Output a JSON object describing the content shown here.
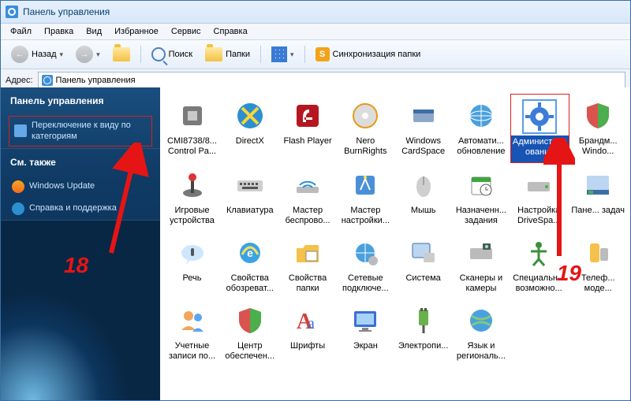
{
  "window": {
    "title": "Панель управления"
  },
  "menu": [
    "Файл",
    "Правка",
    "Вид",
    "Избранное",
    "Сервис",
    "Справка"
  ],
  "toolbar": {
    "back": "Назад",
    "search": "Поиск",
    "folders": "Папки",
    "sync": "Синхронизация папки"
  },
  "address": {
    "label": "Адрес:",
    "value": "Панель управления"
  },
  "sidebar": {
    "section1": {
      "title": "Панель управления",
      "items": [
        "Переключение к виду по категориям"
      ]
    },
    "section2": {
      "title": "См. также",
      "items": [
        "Windows Update",
        "Справка и поддержка"
      ]
    }
  },
  "annotations": {
    "num18": "18",
    "num19": "19"
  },
  "grid_items": [
    {
      "label": "CMI8738/8... Control Pa...",
      "icon": "chip"
    },
    {
      "label": "DirectX",
      "icon": "directx"
    },
    {
      "label": "Flash Player",
      "icon": "flash"
    },
    {
      "label": "Nero BurnRights",
      "icon": "nero"
    },
    {
      "label": "Windows CardSpace",
      "icon": "cardspace"
    },
    {
      "label": "Автомати... обновление",
      "icon": "globe"
    },
    {
      "label": "Администрирование",
      "icon": "gear",
      "selected": true,
      "annot_box": true
    },
    {
      "label": "Брандм... Windo...",
      "icon": "shield"
    },
    {
      "label": "Игровые устройства",
      "icon": "joystick"
    },
    {
      "label": "Клавиатура",
      "icon": "keyboard"
    },
    {
      "label": "Мастер беспрово...",
      "icon": "wifi"
    },
    {
      "label": "Мастер настройки...",
      "icon": "wizard"
    },
    {
      "label": "Мышь",
      "icon": "mouse"
    },
    {
      "label": "Назначенн... задания",
      "icon": "scheduled"
    },
    {
      "label": "Настройка DriveSpa...",
      "icon": "drive"
    },
    {
      "label": "Пане... задач",
      "icon": "taskbar"
    },
    {
      "label": "Речь",
      "icon": "speech"
    },
    {
      "label": "Свойства обозреват...",
      "icon": "ie"
    },
    {
      "label": "Свойства папки",
      "icon": "folderprops"
    },
    {
      "label": "Сетевые подключе...",
      "icon": "network"
    },
    {
      "label": "Система",
      "icon": "system"
    },
    {
      "label": "Сканеры и камеры",
      "icon": "scanner"
    },
    {
      "label": "Специальн... возможно...",
      "icon": "access"
    },
    {
      "label": "Телеф... моде...",
      "icon": "phone"
    },
    {
      "label": "Учетные записи по...",
      "icon": "users"
    },
    {
      "label": "Центр обеспечен...",
      "icon": "security"
    },
    {
      "label": "Шрифты",
      "icon": "fonts"
    },
    {
      "label": "Экран",
      "icon": "display"
    },
    {
      "label": "Электропи...",
      "icon": "power"
    },
    {
      "label": "Язык и региональ...",
      "icon": "regional"
    }
  ],
  "icon_svgs": {
    "chip": "<svg class='icn' viewBox='0 0 40 40'><rect x='8' y='8' width='24' height='24' rx='3' fill='#7a7a7a'/><rect x='14' y='14' width='12' height='12' fill='#c9c9c9'/></svg>",
    "directx": "<svg class='icn' viewBox='0 0 40 40'><circle cx='20' cy='20' r='16' fill='#2c8fd0'/><path d='M10,10 L30,30 M30,10 L10,30' stroke='#ffd53a' stroke-width='4'/></svg>",
    "flash": "<svg class='icn' viewBox='0 0 40 40'><rect x='6' y='6' width='28' height='28' rx='4' fill='#b51720'/><path d='M22,12 q-8,0 -8,10 l0,6 l4,0 l0,-6 q0,-6 4,-6 z M16,22 h10 v3 h-10 z' fill='#fff'/></svg>",
    "nero": "<svg class='icn' viewBox='0 0 40 40'><circle cx='20' cy='20' r='15' fill='#dcdcdc'/><circle cx='20' cy='20' r='4' fill='#fff'/><circle cx='20' cy='20' r='15' fill='none' stroke='#e59b1a' stroke-width='2'/></svg>",
    "cardspace": "<svg class='icn' viewBox='0 0 40 40'><rect x='7' y='12' width='26' height='16' rx='2' fill='#8ea7c9'/><rect x='7' y='12' width='26' height='5' fill='#3d6ea6'/></svg>",
    "globe": "<svg class='icn' viewBox='0 0 40 40'><circle cx='20' cy='20' r='14' fill='#4aa0de'/><ellipse cx='20' cy='20' rx='14' ry='6' fill='none' stroke='#fff'/><path d='M20,6 v28 M6,20 h28' stroke='#fff'/></svg>",
    "gear": "<svg class='icn' viewBox='0 0 40 40'><circle cx='20' cy='20' r='12' fill='#3b7dd8'/><circle cx='20' cy='20' r='5' fill='#fff'/><g fill='#3b7dd8'><rect x='18' y='2' width='4' height='6'/><rect x='18' y='32' width='4' height='6'/><rect x='2' y='18' width='6' height='4'/><rect x='32' y='18' width='6' height='4'/></g></svg>",
    "shield": "<svg class='icn' viewBox='0 0 40 40'><path d='M20,4 l14,5 v10 c0,10 -7,15 -14,17 c-7,-2 -14,-7 -14,-17 v-10 z' fill='#d9534f'/><path d='M20,4 l14,5 v10 c0,10 -7,15 -14,17 z' fill='#4cae4c'/></svg>",
    "joystick": "<svg class='icn' viewBox='0 0 40 40'><ellipse cx='20' cy='30' rx='12' ry='5' fill='#777'/><rect x='18' y='12' width='4' height='18' fill='#444'/><circle cx='20' cy='10' r='5' fill='#d33'/></svg>",
    "keyboard": "<svg class='icn' viewBox='0 0 40 40'><rect x='4' y='14' width='32' height='14' rx='2' fill='#cfcfcf'/><g fill='#555'><rect x='7' y='17' width='3' height='3'/><rect x='12' y='17' width='3' height='3'/><rect x='17' y='17' width='3' height='3'/><rect x='22' y='17' width='3' height='3'/><rect x='27' y='17' width='3' height='3'/><rect x='10' y='22' width='20' height='3'/></g></svg>",
    "wifi": "<svg class='icn' viewBox='0 0 40 40'><rect x='6' y='22' width='28' height='8' rx='2' fill='#bbb'/><path d='M10,20 a14,14 0 0 1 20,0' fill='none' stroke='#2c8fd0' stroke-width='2'/><path d='M14,23 a8,8 0 0 1 12,0' fill='none' stroke='#2c8fd0' stroke-width='2'/></svg>",
    "wizard": "<svg class='icn' viewBox='0 0 40 40'><rect x='8' y='8' width='24' height='24' rx='3' fill='#4a90d9'/><path d='M14,26 l6,-14 l6,14' fill='none' stroke='#fff' stroke-width='2'/><circle cx='20' cy='10' r='2' fill='#ffeb3b'/></svg>",
    "mouse": "<svg class='icn' viewBox='0 0 40 40'><ellipse cx='20' cy='22' rx='9' ry='13' fill='#cfcfcf'/><line x1='20' y1='9' x2='20' y2='20' stroke='#777'/></svg>",
    "scheduled": "<svg class='icn' viewBox='0 0 40 40'><rect x='8' y='10' width='24' height='22' rx='2' fill='#fff' stroke='#888'/><rect x='8' y='10' width='24' height='6' fill='#40a540'/><circle cx='26' cy='26' r='7' fill='#fff' stroke='#555'/><path d='M26,22 v4 h3' stroke='#555' fill='none'/></svg>",
    "drive": "<svg class='icn' viewBox='0 0 40 40'><rect x='6' y='16' width='28' height='12' rx='2' fill='#bdbdbd'/><circle cx='30' cy='22' r='2' fill='#4caf50'/></svg>",
    "taskbar": "<svg class='icn' viewBox='0 0 40 40'><rect x='6' y='8' width='28' height='24' rx='2' fill='#bcd6f2'/><rect x='6' y='26' width='28' height='6' fill='#3d6ea6'/><rect x='8' y='27' width='6' height='4' fill='#4caf50'/></svg>",
    "speech": "<svg class='icn' viewBox='0 0 40 40'><ellipse cx='20' cy='20' rx='14' ry='10' fill='#cfe6ff'/><path d='M16,30 l-4,6 l2,-8' fill='#cfe6ff'/><rect x='18' y='14' width='4' height='10' rx='2' fill='#555'/></svg>",
    "ie": "<svg class='icn' viewBox='0 0 40 40'><circle cx='20' cy='20' r='13' fill='#3aa3e3'/><path d='M10,22 q10,-18 20,0' fill='none' stroke='#ffdf5a' stroke-width='3'/><text x='20' y='25' font-size='14' fill='#fff' text-anchor='middle' font-weight='bold'>e</text></svg>",
    "folderprops": "<svg class='icn' viewBox='0 0 40 40'><path d='M6,14 h8 l3,-4 h17 v22 h-28 z' fill='#f4c14a'/><rect x='18' y='18' width='14' height='12' fill='#fff' stroke='#888'/></svg>",
    "network": "<svg class='icn' viewBox='0 0 40 40'><circle cx='20' cy='20' r='12' fill='#4aa0de'/><path d='M8,20 h24 M20,8 v24' stroke='#fff'/><circle cx='30' cy='30' r='6' fill='#bbb'/></svg>",
    "system": "<svg class='icn' viewBox='0 0 40 40'><rect x='6' y='8' width='22' height='18' rx='2' fill='#bcd6f2' stroke='#3d6ea6'/><rect x='20' y='20' width='14' height='12' rx='2' fill='#ccc'/></svg>",
    "scanner": "<svg class='icn' viewBox='0 0 40 40'><rect x='6' y='14' width='28' height='14' rx='2' fill='#bbb'/><rect x='22' y='8' width='10' height='8' rx='1' fill='#555'/><circle cx='27' cy='12' r='2' fill='#7fc'/></svg>",
    "access": "<svg class='icn' viewBox='0 0 40 40'><circle cx='20' cy='10' r='4' fill='#3c8f3c'/><path d='M10,18 h20 M20,14 v14 M20,28 l-7,8 M20,28 l7,8' stroke='#3c8f3c' stroke-width='3' fill='none'/></svg>",
    "phone": "<svg class='icn' viewBox='0 0 40 40'><rect x='10' y='8' width='12' height='24' rx='3' fill='#f4c14a'/><rect x='23' y='14' width='10' height='16' rx='2' fill='#bbb'/></svg>",
    "users": "<svg class='icn' viewBox='0 0 40 40'><circle cx='15' cy='14' r='6' fill='#f2a65a'/><circle cx='27' cy='16' r='5' fill='#5aa6f2'/><path d='M6,32 q9,-10 18,0 z' fill='#f2a65a'/><path d='M20,34 q7,-9 14,0 z' fill='#5aa6f2'/></svg>",
    "security": "<svg class='icn' viewBox='0 0 40 40'><path d='M20,4 l14,5 v10 c0,10 -7,15 -14,17 c-7,-2 -14,-7 -14,-17 v-10 z' fill='#d9534f'/><path d='M20,4 v32 c7,-2 14,-7 14,-17 v-10 z' fill='#4cae4c'/></svg>",
    "fonts": "<svg class='icn' viewBox='0 0 40 40'><text x='6' y='30' font-size='28' font-family='Georgia' fill='#d43f3a' font-weight='bold'>A</text><text x='20' y='30' font-size='20' font-family='Georgia' fill='#3a6fd4'>a</text></svg>",
    "display": "<svg class='icn' viewBox='0 0 40 40'><rect x='6' y='8' width='28' height='20' rx='2' fill='#3a6fd4'/><rect x='9' y='11' width='22' height='14' fill='#a7d2f7'/><rect x='16' y='29' width='8' height='3' fill='#888'/><rect x='12' y='32' width='16' height='2' fill='#888'/></svg>",
    "power": "<svg class='icn' viewBox='0 0 40 40'><rect x='14' y='6' width='12' height='20' rx='2' fill='#6ab04c'/><rect x='16' y='4' width='3' height='4' fill='#555'/><rect x='21' y='4' width='3' height='4' fill='#555'/><path d='M20,26 v10' stroke='#555' stroke-width='3'/></svg>",
    "regional": "<svg class='icn' viewBox='0 0 40 40'><circle cx='20' cy='20' r='14' fill='#4aa0de'/><path d='M8,14 q12,8 24,0 M8,26 q12,-8 24,0' fill='none' stroke='#7fc97f' stroke-width='3'/></svg>"
  }
}
